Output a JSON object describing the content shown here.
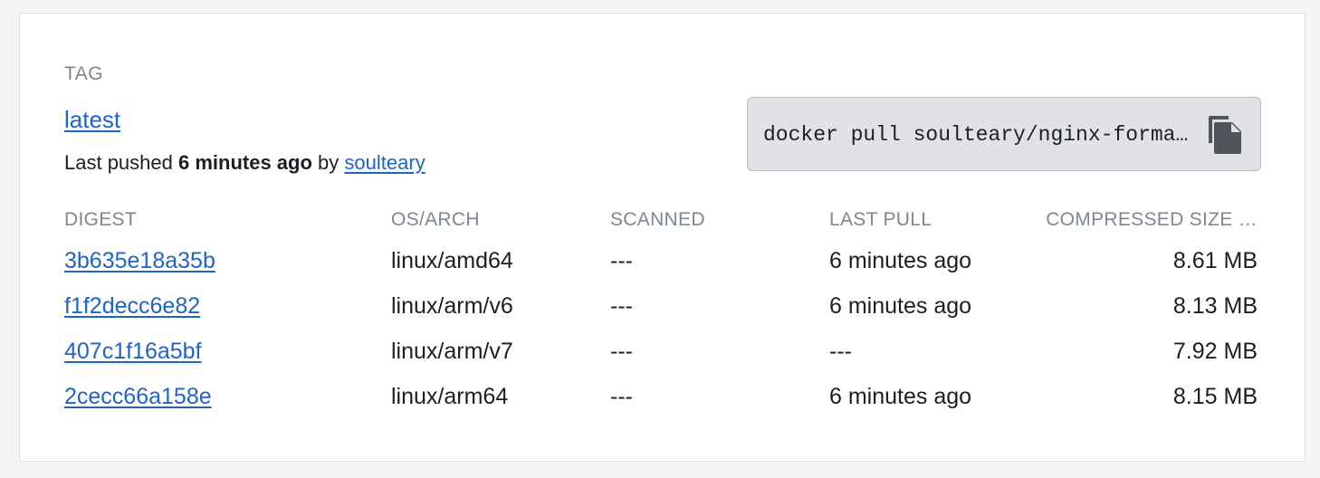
{
  "tag": {
    "section_label": "TAG",
    "name": "latest",
    "pushed_prefix": "Last pushed",
    "pushed_time": "6 minutes ago",
    "pushed_by_word": "by",
    "pushed_by_user": "soulteary"
  },
  "pull": {
    "command": "docker pull soulteary/nginx-formatted-json:latest",
    "copy_icon": "copy-icon"
  },
  "table": {
    "headers": {
      "digest": "DIGEST",
      "os_arch": "OS/ARCH",
      "scanned": "SCANNED",
      "last_pull": "LAST PULL",
      "compressed_size": "COMPRESSED SIZE …"
    },
    "rows": [
      {
        "digest": "3b635e18a35b",
        "os_arch": "linux/amd64",
        "scanned": "---",
        "last_pull": "6 minutes ago",
        "size": "8.61 MB"
      },
      {
        "digest": "f1f2decc6e82",
        "os_arch": "linux/arm/v6",
        "scanned": "---",
        "last_pull": "6 minutes ago",
        "size": "8.13 MB"
      },
      {
        "digest": "407c1f16a5bf",
        "os_arch": "linux/arm/v7",
        "scanned": "---",
        "last_pull": "---",
        "size": "7.92 MB"
      },
      {
        "digest": "2cecc66a158e",
        "os_arch": "linux/arm64",
        "scanned": "---",
        "last_pull": "6 minutes ago",
        "size": "8.15 MB"
      }
    ]
  },
  "colors": {
    "link": "#1f63c9",
    "muted": "#7d8794",
    "command_bg": "#e1e2e6"
  }
}
